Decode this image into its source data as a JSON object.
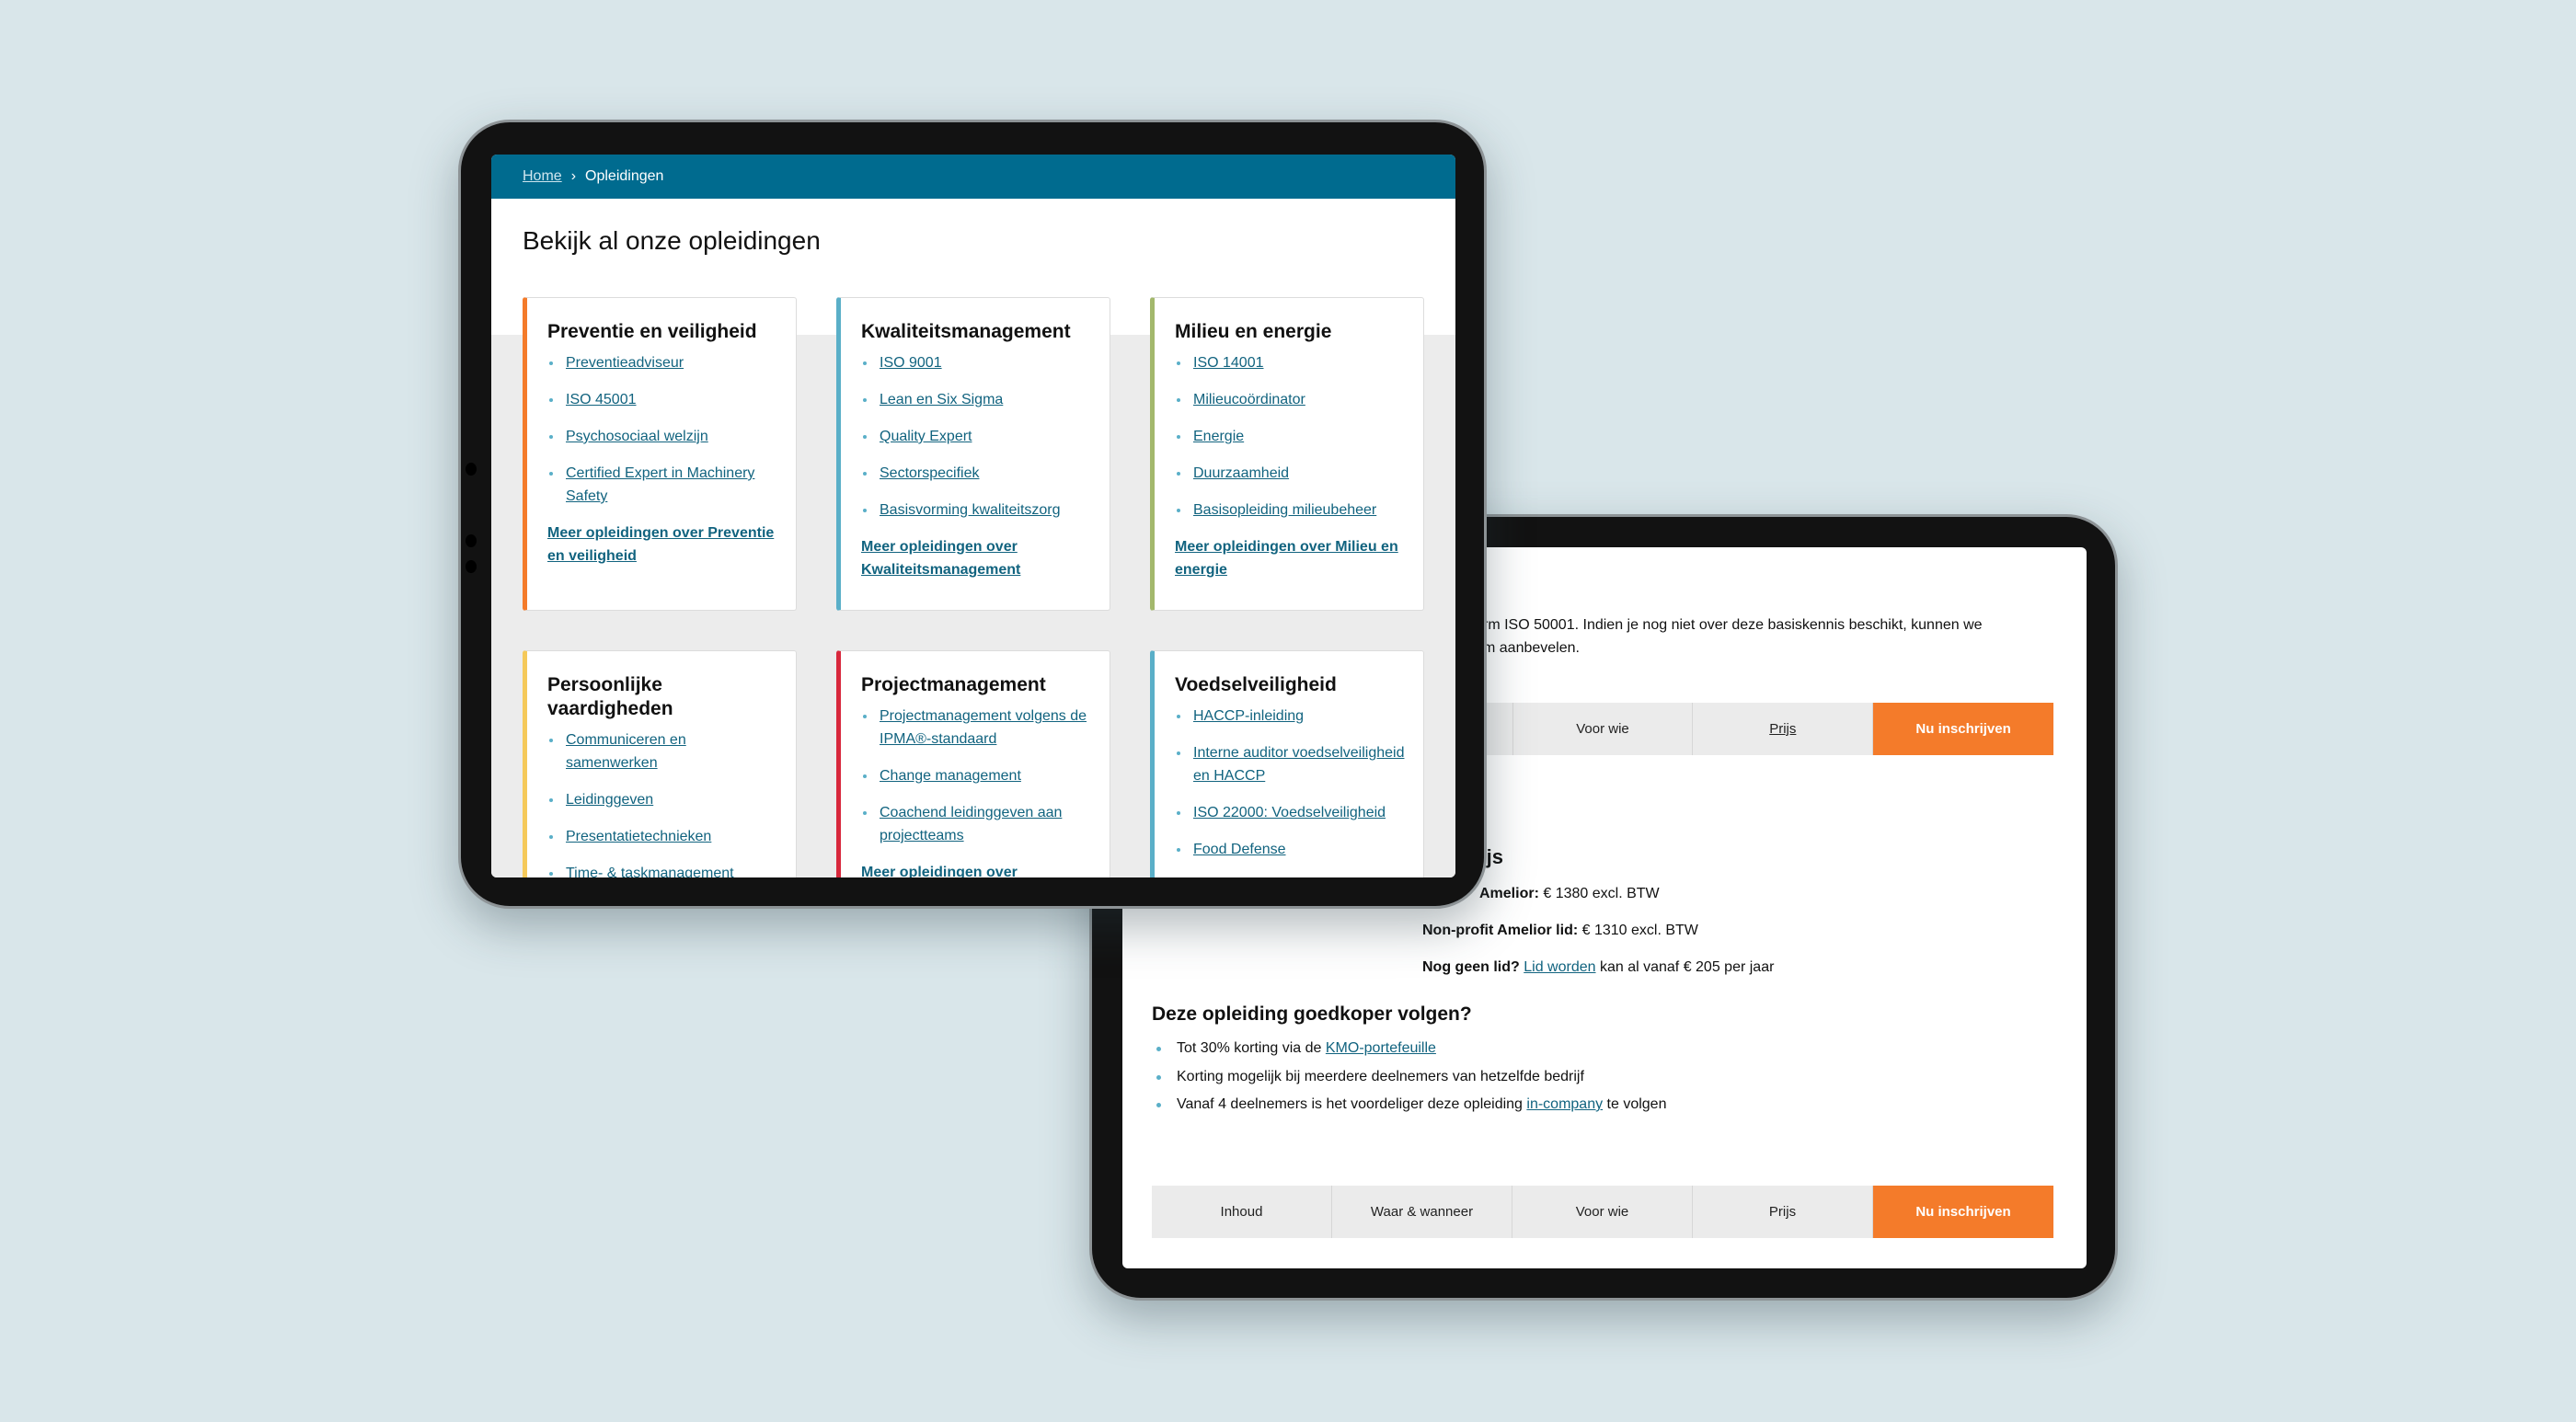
{
  "colors": {
    "header": "#006b8f",
    "accent_orange": "#f47b2a",
    "link": "#11637f",
    "background": "#d9e6ea"
  },
  "tablet1": {
    "breadcrumb": {
      "home": "Home",
      "separator": "›",
      "current": "Opleidingen"
    },
    "title": "Bekijk al onze opleidingen",
    "cards": [
      {
        "title": "Preventie en veiligheid",
        "color": "#f47b2a",
        "links": [
          "Preventieadviseur",
          "ISO 45001",
          "Psychosociaal welzijn",
          "Certified Expert in Machinery Safety"
        ],
        "more": "Meer opleidingen over Preventie en veiligheid"
      },
      {
        "title": "Kwaliteitsmanagement",
        "color": "#5aafc8",
        "links": [
          "ISO 9001",
          "Lean en Six Sigma",
          "Quality Expert",
          "Sectorspecifiek",
          "Basisvorming kwaliteitszorg"
        ],
        "more": "Meer opleidingen over Kwaliteitsmanagement"
      },
      {
        "title": "Milieu en energie",
        "color": "#a3b86c",
        "links": [
          "ISO 14001",
          "Milieucoördinator",
          "Energie",
          "Duurzaamheid",
          "Basisopleiding milieubeheer"
        ],
        "more": "Meer opleidingen over Milieu en energie"
      },
      {
        "title": "Persoonlijke vaardigheden",
        "color": "#f5c95a",
        "links": [
          "Communiceren en samenwerken",
          "Leidinggeven",
          "Presentatietechnieken",
          "Time- & taskmanagement"
        ],
        "more": ""
      },
      {
        "title": "Projectmanagement",
        "color": "#d8283c",
        "links": [
          "Projectmanagement volgens de IPMA®-standaard",
          "Change management",
          "Coachend leidinggeven aan projectteams"
        ],
        "more": "Meer opleidingen over"
      },
      {
        "title": "Voedselveiligheid",
        "color": "#5aafc8",
        "links": [
          "HACCP-inleiding",
          "Interne auditor voedselveiligheid en HACCP",
          "ISO 22000: Voedselveiligheid",
          "Food Defense"
        ],
        "more": ""
      }
    ]
  },
  "tablet2": {
    "intro_line1": "rm ISO 50001. Indien je nog niet over deze basiskennis beschikt, kunnen we",
    "intro_line2": "m aanbevelen.",
    "top_tabs": [
      "Voor wie",
      "Prijs",
      "Nu inschrijven"
    ],
    "price_heading": "rijs",
    "price1_label": "Amelior:",
    "price1_value": " € 1380 excl. BTW",
    "price2_label": "Non-profit Amelior lid:",
    "price2_value": " € 1310 excl. BTW",
    "price3_label": "Nog geen lid?",
    "price3_link": "Lid worden",
    "price3_rest": " kan al vanaf € 205 per jaar",
    "cheaper_heading": "Deze opleiding goedkoper volgen?",
    "bullet1_pre": "Tot 30% korting via de ",
    "bullet1_link": "KMO-portefeuille",
    "bullet2": "Korting mogelijk bij meerdere deelnemers van hetzelfde bedrijf",
    "bullet3_pre": "Vanaf 4 deelnemers is het voordeliger deze opleiding ",
    "bullet3_link": "in-company",
    "bullet3_post": " te volgen",
    "bottom_tabs": [
      "Inhoud",
      "Waar & wanneer",
      "Voor wie",
      "Prijs",
      "Nu inschrijven"
    ]
  }
}
